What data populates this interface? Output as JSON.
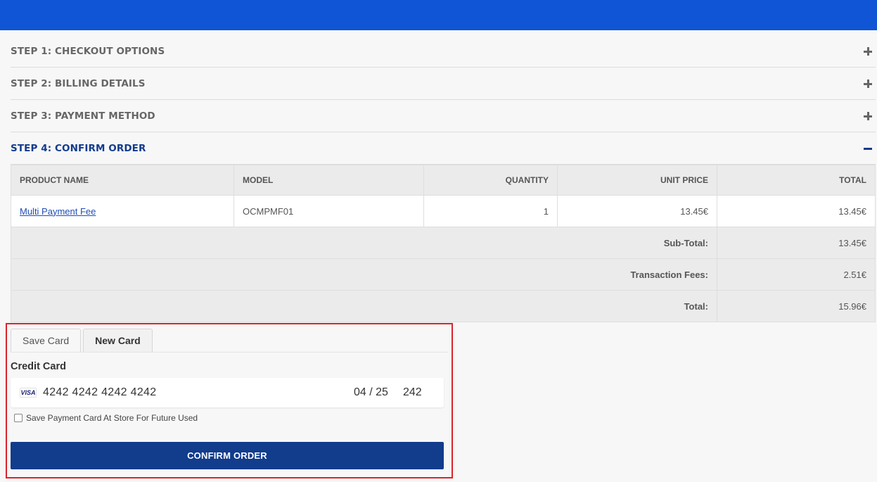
{
  "colors": {
    "header": "#0f55d6",
    "accent": "#123c8c",
    "highlight_border": "#d9242b"
  },
  "steps": [
    {
      "title": "STEP 1: CHECKOUT OPTIONS",
      "icon": "plus-icon"
    },
    {
      "title": "STEP 2: BILLING DETAILS",
      "icon": "plus-icon"
    },
    {
      "title": "STEP 3: PAYMENT METHOD",
      "icon": "plus-icon"
    },
    {
      "title": "STEP 4: CONFIRM ORDER",
      "icon": "minus-icon"
    }
  ],
  "order": {
    "columns": [
      "PRODUCT NAME",
      "MODEL",
      "QUANTITY",
      "UNIT PRICE",
      "TOTAL"
    ],
    "rows": [
      {
        "product": "Multi Payment Fee",
        "model": "OCMPMF01",
        "quantity": "1",
        "unit_price": "13.45€",
        "total": "13.45€"
      }
    ],
    "totals": [
      {
        "label": "Sub-Total:",
        "value": "13.45€"
      },
      {
        "label": "Transaction Fees:",
        "value": "2.51€"
      },
      {
        "label": "Total:",
        "value": "15.96€"
      }
    ]
  },
  "payment": {
    "tabs": [
      "Save Card",
      "New Card"
    ],
    "active_tab": "New Card",
    "section_label": "Credit Card",
    "card_brand": "VISA",
    "card_number": "4242 4242 4242 4242",
    "card_expiry": "04 / 25",
    "card_cvc": "242",
    "save_checkbox_label": "Save Payment Card At Store For Future Used",
    "save_checked": false,
    "confirm_label": "CONFIRM ORDER"
  }
}
